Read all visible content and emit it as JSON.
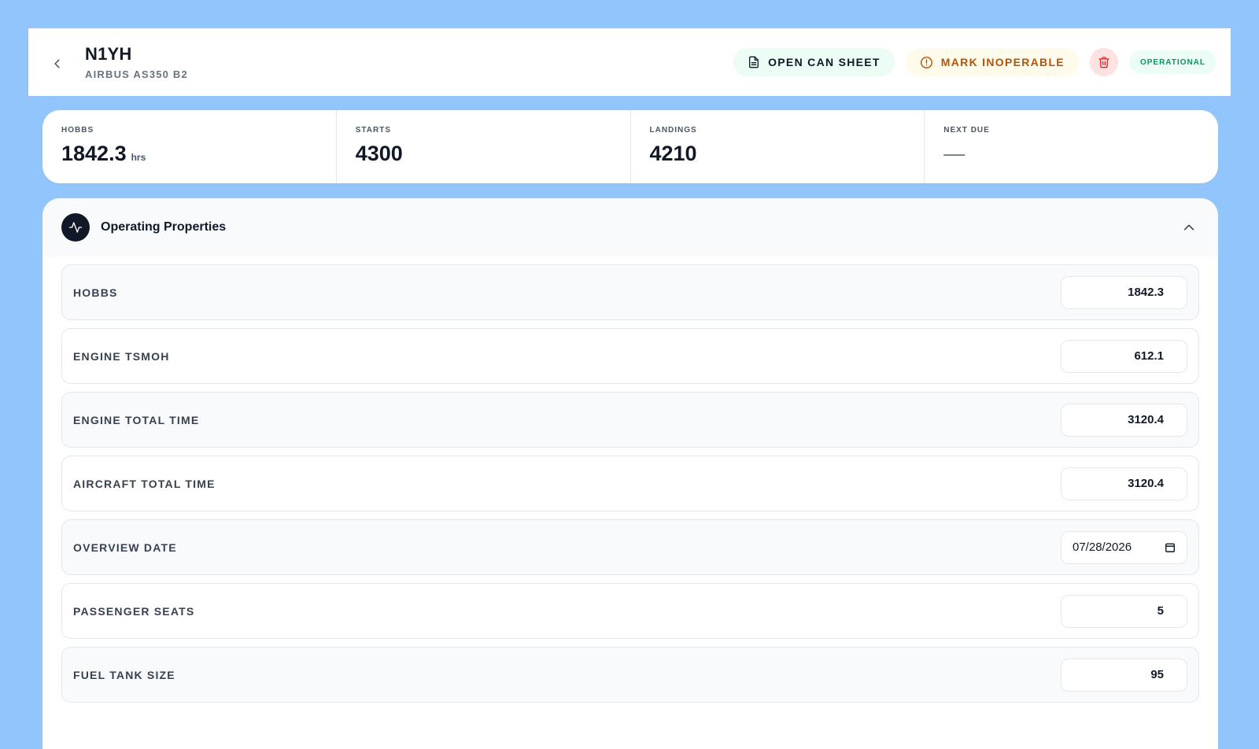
{
  "header": {
    "tail_number": "N1YH",
    "model": "AIRBUS AS350 B2",
    "open_can_sheet_label": "OPEN CAN SHEET",
    "mark_inoperable_label": "MARK INOPERABLE",
    "status_badge": "OPERATIONAL",
    "icons": {
      "back": "chevron-left-icon",
      "can_sheet": "document-icon",
      "inoperable": "alert-circle-icon",
      "delete": "trash-icon"
    }
  },
  "stats": {
    "hobbs": {
      "label": "HOBBS",
      "value": "1842.3",
      "unit": "hrs"
    },
    "starts": {
      "label": "STARTS",
      "value": "4300"
    },
    "landings": {
      "label": "LANDINGS",
      "value": "4210"
    },
    "next_due": {
      "label": "NEXT DUE",
      "value": "—"
    }
  },
  "panel": {
    "title": "Operating Properties",
    "icon": "activity-icon",
    "collapse_icon": "chevron-up-icon",
    "rows": [
      {
        "label": "HOBBS",
        "value": "1842.3"
      },
      {
        "label": "ENGINE TSMOH",
        "value": "612.1"
      },
      {
        "label": "ENGINE TOTAL TIME",
        "value": "3120.4"
      },
      {
        "label": "AIRCRAFT TOTAL TIME",
        "value": "3120.4"
      },
      {
        "label": "OVERVIEW DATE",
        "value": "07/28/2026"
      },
      {
        "label": "PASSENGER SEATS",
        "value": "5"
      },
      {
        "label": "FUEL TANK SIZE",
        "value": "95"
      }
    ]
  },
  "colors": {
    "background": "#93c5fd",
    "inoperable_text": "#b45309",
    "status_text": "#059669",
    "delete_icon": "#dc2626"
  }
}
